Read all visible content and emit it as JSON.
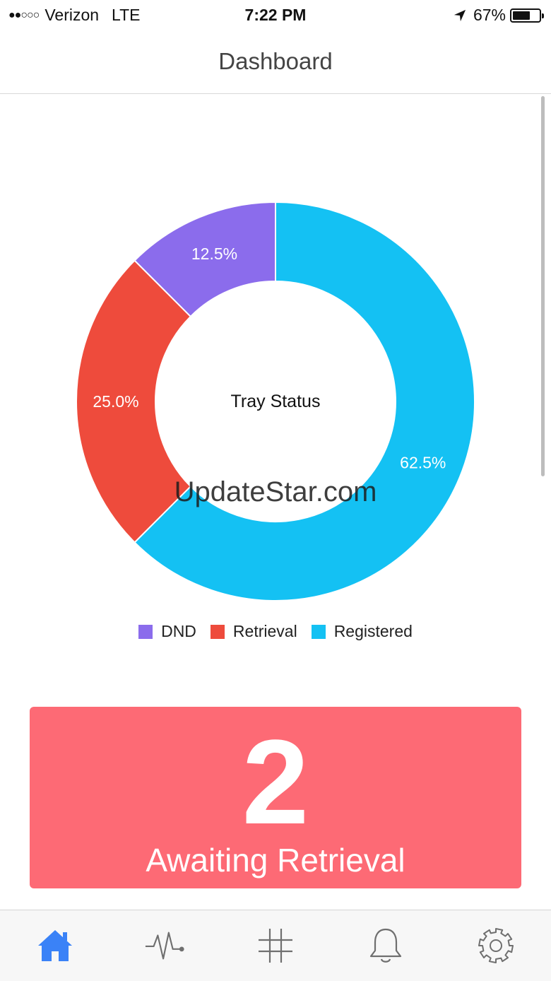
{
  "status_bar": {
    "signal": "●●○○○",
    "carrier": "Verizon",
    "network": "LTE",
    "time": "7:22 PM",
    "battery": "67%",
    "battery_level": 0.67
  },
  "nav": {
    "title": "Dashboard"
  },
  "chart_data": {
    "type": "pie",
    "title": "Tray Status",
    "donut": true,
    "categories": [
      "Registered",
      "Retrieval",
      "DND"
    ],
    "values": [
      62.5,
      25.0,
      12.5
    ],
    "labels": [
      "62.5%",
      "25.0%",
      "12.5%"
    ],
    "colors": [
      "#14c1f3",
      "#ee4b3c",
      "#8b6cec"
    ],
    "legend": [
      {
        "label": "DND",
        "color": "#8b6cec"
      },
      {
        "label": "Retrieval",
        "color": "#ee4b3c"
      },
      {
        "label": "Registered",
        "color": "#14c1f3"
      }
    ],
    "legend_position": "bottom"
  },
  "watermark": "UpdateStar.com",
  "awaiting": {
    "count": "2",
    "label": "Awaiting Retrieval",
    "color": "#fd6a75"
  },
  "tabs": [
    {
      "id": "home",
      "icon": "home-icon",
      "active": true,
      "color": "#3a82f7"
    },
    {
      "id": "activity",
      "icon": "activity-icon",
      "active": false,
      "color": "#6f6f6f"
    },
    {
      "id": "grid",
      "icon": "hashtag-icon",
      "active": false,
      "color": "#6f6f6f"
    },
    {
      "id": "notifications",
      "icon": "bell-icon",
      "active": false,
      "color": "#6f6f6f"
    },
    {
      "id": "settings",
      "icon": "gear-icon",
      "active": false,
      "color": "#6f6f6f"
    }
  ]
}
